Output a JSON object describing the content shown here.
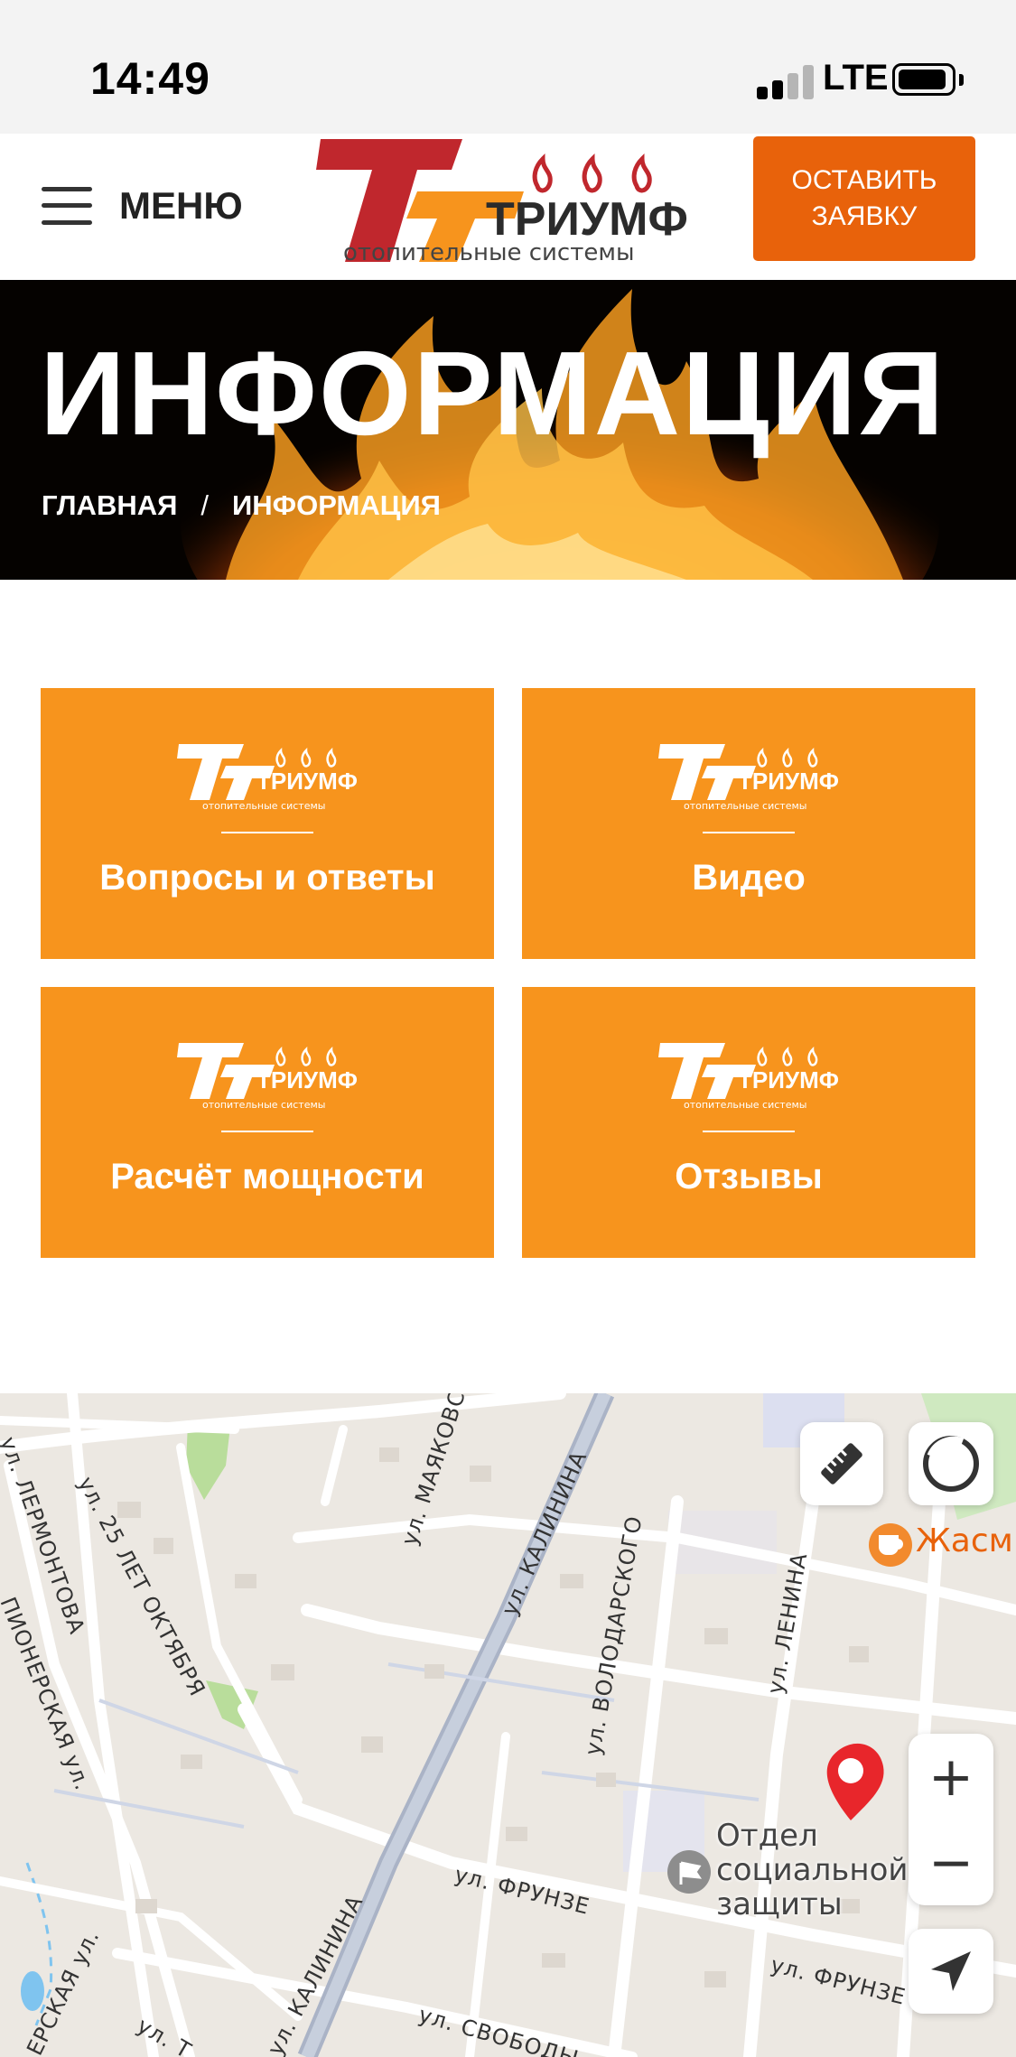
{
  "status_bar": {
    "time": "14:49",
    "network": "LTE"
  },
  "header": {
    "menu_label": "МЕНЮ",
    "logo_name": "ТРИУМФ",
    "logo_tagline": "отопительные системы",
    "cta_label": "ОСТАВИТЬ ЗАЯВКУ",
    "brand_red": "#c0272d",
    "brand_orange": "#f7941d",
    "cta_color": "#e8620b"
  },
  "hero": {
    "title": "ИНФОРМАЦИЯ",
    "breadcrumbs": [
      "ГЛАВНАЯ",
      "ИНФОРМАЦИЯ"
    ],
    "separator": "/"
  },
  "tiles": [
    {
      "label": "Вопросы и ответы"
    },
    {
      "label": "Видео"
    },
    {
      "label": "Расчёт мощности"
    },
    {
      "label": "Отзывы"
    }
  ],
  "map": {
    "streets": [
      "ул. ЛЕРМОНТОВА",
      "ул. 25 ЛЕТ ОКТЯБРЯ",
      "ул. МАЯКОВС",
      "ул. КАЛИНИНА",
      "ул. ВОЛОДАРСКОГО",
      "ул. ЛЕНИНА",
      "ПИОНЕРСКАЯ ул.",
      "ул. ФРУНЗЕ",
      "ул. КАЛИНИНА",
      "ул. ФРУНЗЕ",
      "ул. СВОБОДЫ",
      "ЕРСКАЯ ул.",
      "ул. Т"
    ],
    "cafe": "Жасми",
    "poi": [
      "Отдел",
      "социальной",
      "защиты"
    ],
    "controls": {
      "ruler": "ruler-icon",
      "traffic": "traffic-icon",
      "zoom_in": "+",
      "zoom_out": "−",
      "locate": "location-arrow-icon"
    }
  }
}
